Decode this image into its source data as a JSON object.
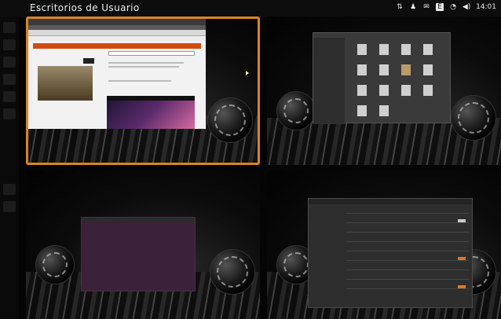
{
  "top_panel": {
    "title": "Escritorios de Usuario",
    "clock": "14:01"
  },
  "accent_colors": {
    "workspace_highlight": "#d98426",
    "browser_nav": "#d24c0e"
  },
  "workspaces": [
    {
      "name": "workspace-1",
      "active": true,
      "window": "browser"
    },
    {
      "name": "workspace-2",
      "active": false,
      "window": "file-manager"
    },
    {
      "name": "workspace-3",
      "active": false,
      "window": "terminal"
    },
    {
      "name": "workspace-4",
      "active": false,
      "window": "settings"
    }
  ]
}
